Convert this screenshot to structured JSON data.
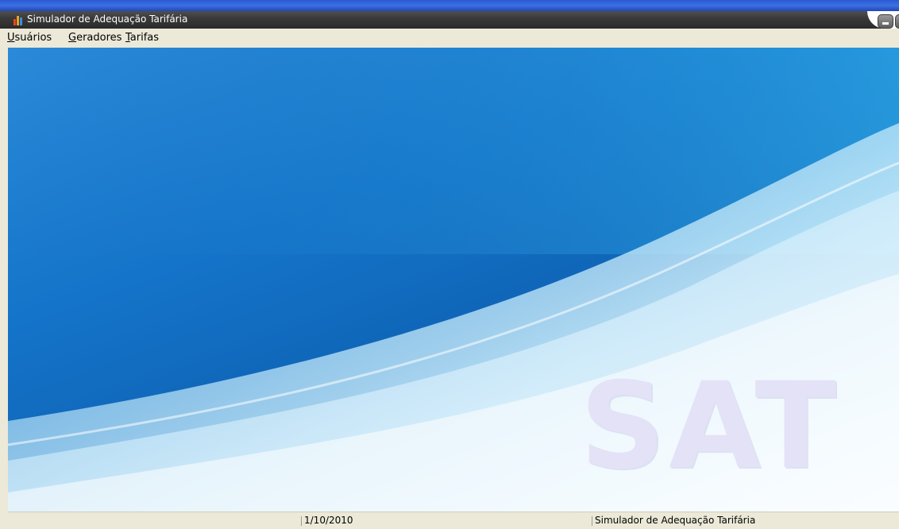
{
  "window": {
    "title": "Simulador de Adequação Tarifária"
  },
  "menu": {
    "items": [
      {
        "accel": "U",
        "rest": "suários"
      },
      {
        "accel": "G",
        "rest": "eradores"
      },
      {
        "accel": "T",
        "rest": "arifas"
      }
    ]
  },
  "splash": {
    "logo": "SAT"
  },
  "status": {
    "date": "1/10/2010",
    "app_name": "Simulador de Adequação Tarifária"
  },
  "colors": {
    "background_blue": "#1474c9",
    "logo": "#e4e2f7",
    "chrome": "#ece9d8"
  },
  "icons": {
    "app": "bar-chart-icon",
    "minimize": "minimize-icon"
  }
}
